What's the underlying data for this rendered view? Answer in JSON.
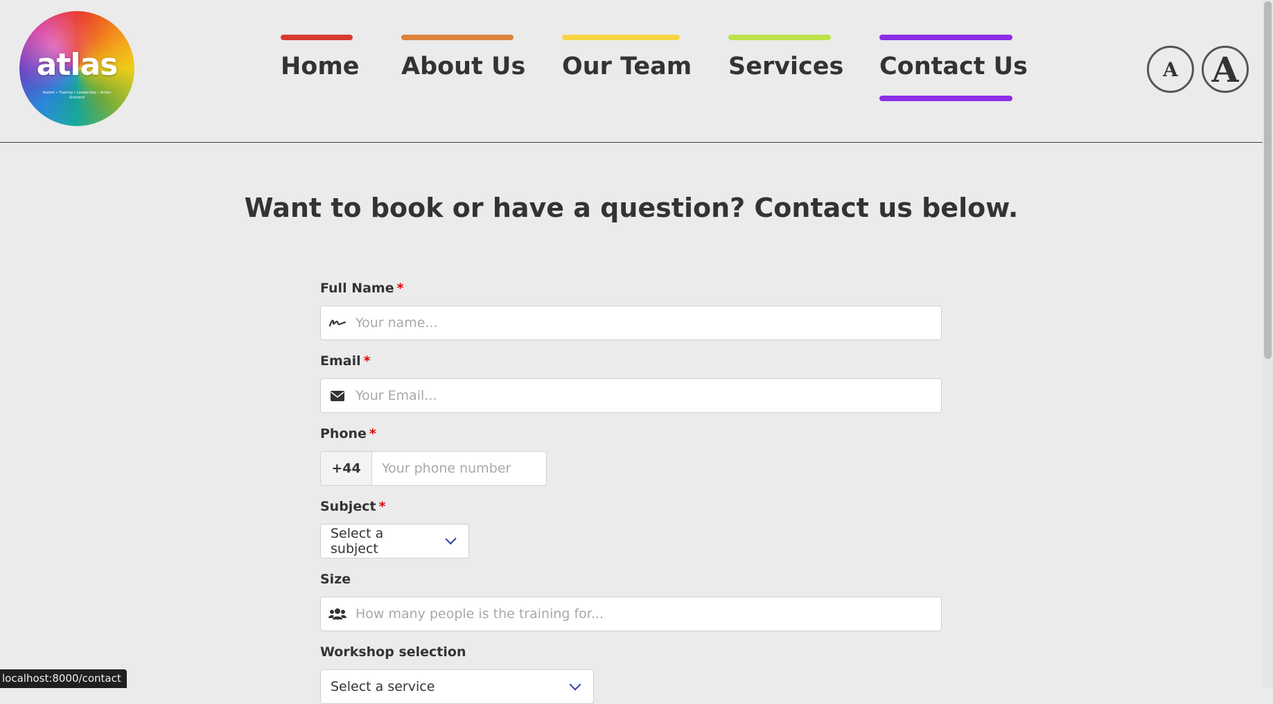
{
  "logo": {
    "text": "atlas",
    "tagline": "Autism • Training • Leadership • Action Scotland"
  },
  "nav": {
    "items": [
      {
        "label": "Home",
        "color": "#d93a2f",
        "active": false
      },
      {
        "label": "About Us",
        "color": "#dc843a",
        "active": false
      },
      {
        "label": "Our Team",
        "color": "#f7d443",
        "active": false
      },
      {
        "label": "Services",
        "color": "#bce24a",
        "active": false
      },
      {
        "label": "Contact Us",
        "color": "#8a2ee6",
        "active": true
      }
    ]
  },
  "font_controls": {
    "small_label": "A",
    "large_label": "A"
  },
  "page": {
    "heading": "Want to book or have a question? Contact us below."
  },
  "form": {
    "full_name": {
      "label": "Full Name",
      "required_mark": "*",
      "placeholder": "Your name...",
      "icon": "signature-icon"
    },
    "email": {
      "label": "Email",
      "required_mark": "*",
      "placeholder": "Your Email...",
      "icon": "envelope-icon"
    },
    "phone": {
      "label": "Phone",
      "required_mark": "*",
      "prefix": "+44",
      "placeholder": "Your phone number"
    },
    "subject": {
      "label": "Subject",
      "required_mark": "*",
      "selected": "Select a subject"
    },
    "size": {
      "label": "Size",
      "placeholder": "How many people is the training for...",
      "icon": "users-icon"
    },
    "workshop": {
      "label": "Workshop selection",
      "selected": "Select a service"
    }
  },
  "status_bar": {
    "url": "localhost:8000/contact"
  }
}
